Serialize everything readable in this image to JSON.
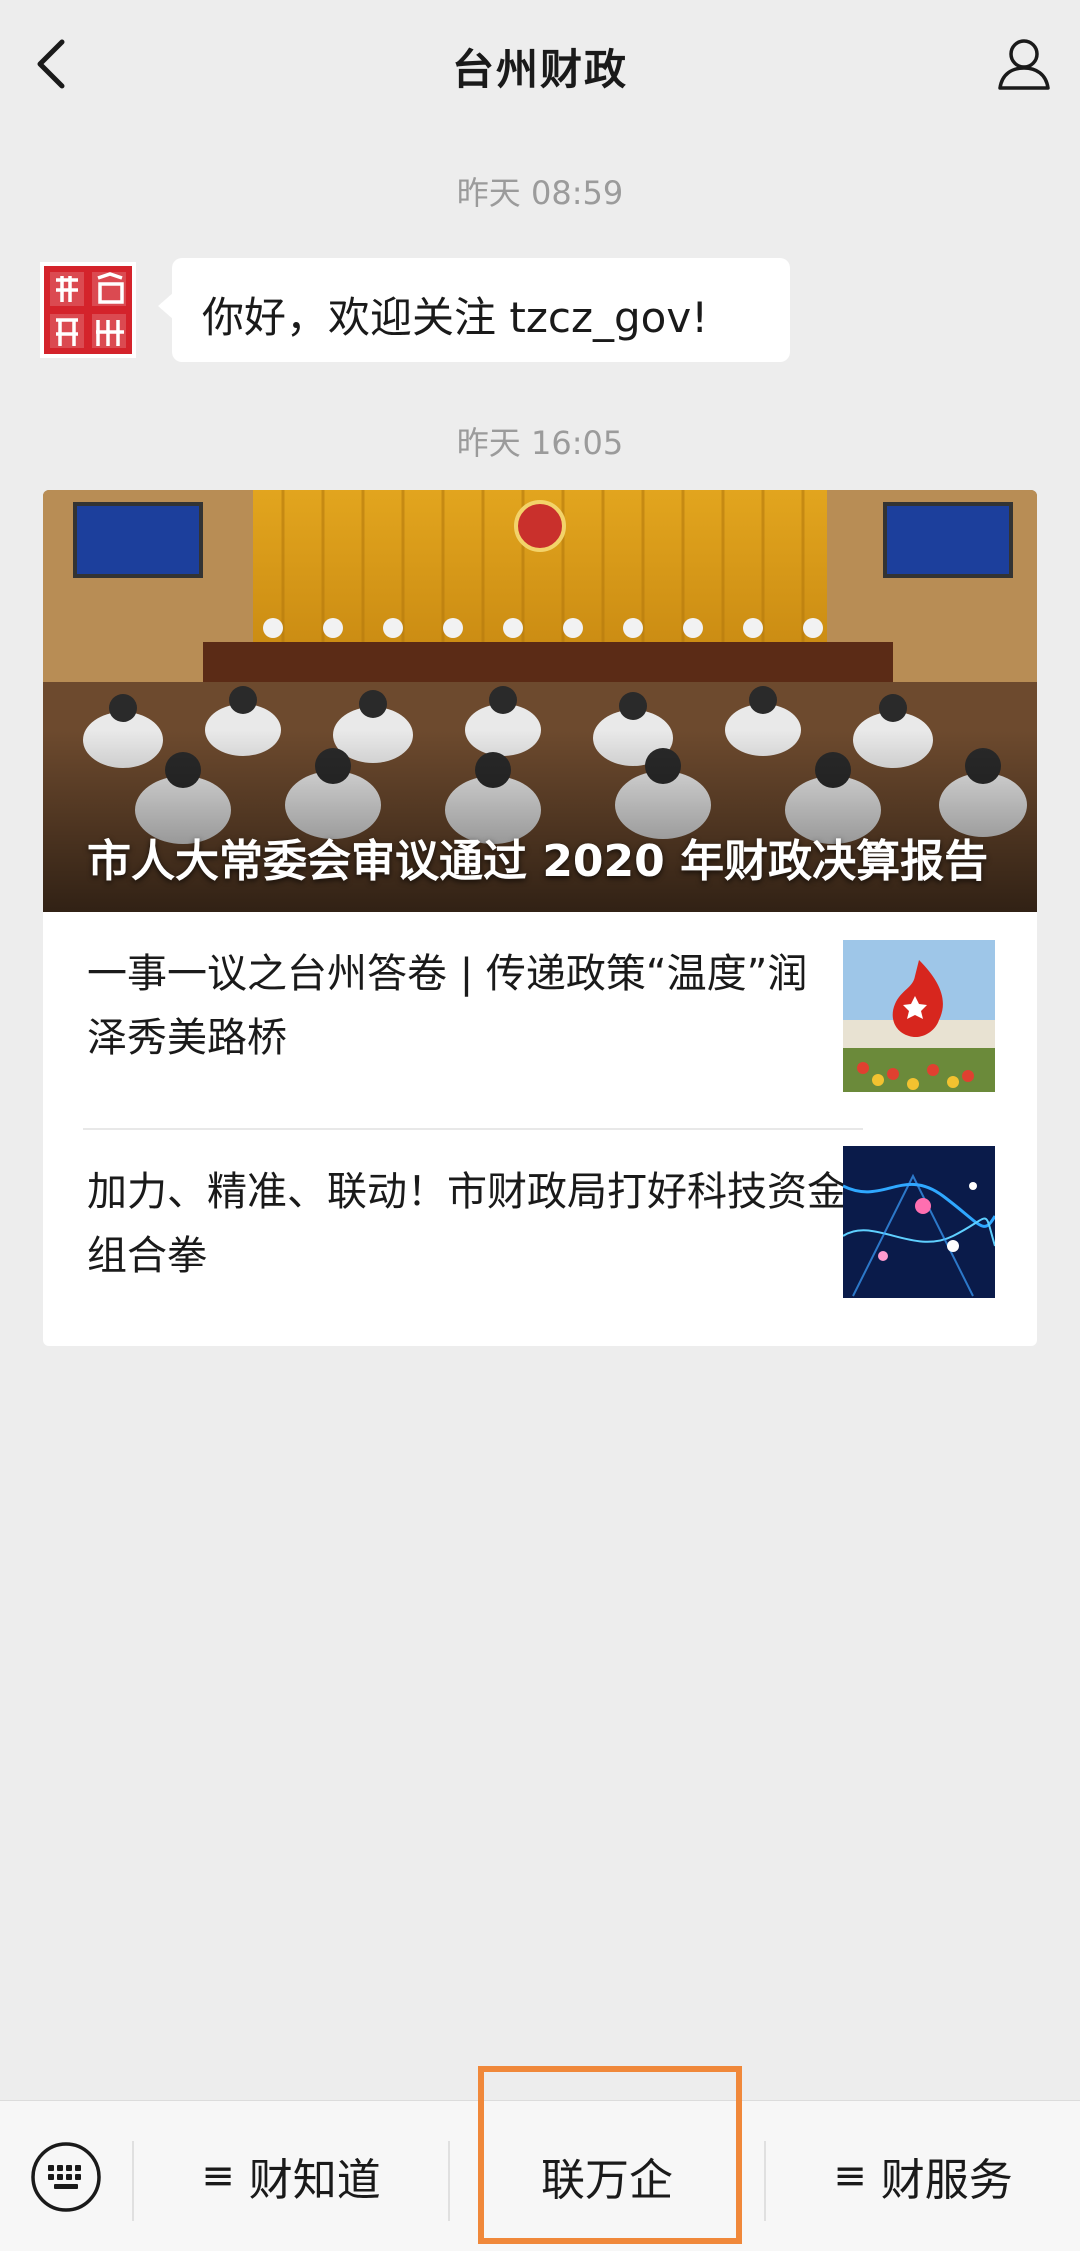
{
  "nav": {
    "title": "台州财政",
    "back_icon": "chevron-left-icon",
    "profile_icon": "user-icon"
  },
  "messages": [
    {
      "timestamp": "昨天 08:59",
      "text": "你好，欢迎关注 tzcz_gov!",
      "avatar_icon": "taizhou-finance-seal-logo"
    },
    {
      "timestamp": "昨天 16:05"
    }
  ],
  "news_card": {
    "headline": "市人大常委会审议通过 2020 年财政决算报告",
    "articles": [
      {
        "title": "一事一议之台州答卷 | 传递政策“温度”润泽秀美路桥"
      },
      {
        "title": "加力、精准、联动！市财政局打好科技资金组合拳"
      }
    ]
  },
  "bottom_menu": {
    "keyboard_icon": "keyboard-icon",
    "items": [
      {
        "label": "财知道",
        "has_submenu": true
      },
      {
        "label": "联万企",
        "has_submenu": false,
        "highlighted": true
      },
      {
        "label": "财服务",
        "has_submenu": true
      }
    ]
  },
  "colors": {
    "background": "#ededed",
    "highlight_border": "#f0883a",
    "seal_red": "#d4232b"
  }
}
